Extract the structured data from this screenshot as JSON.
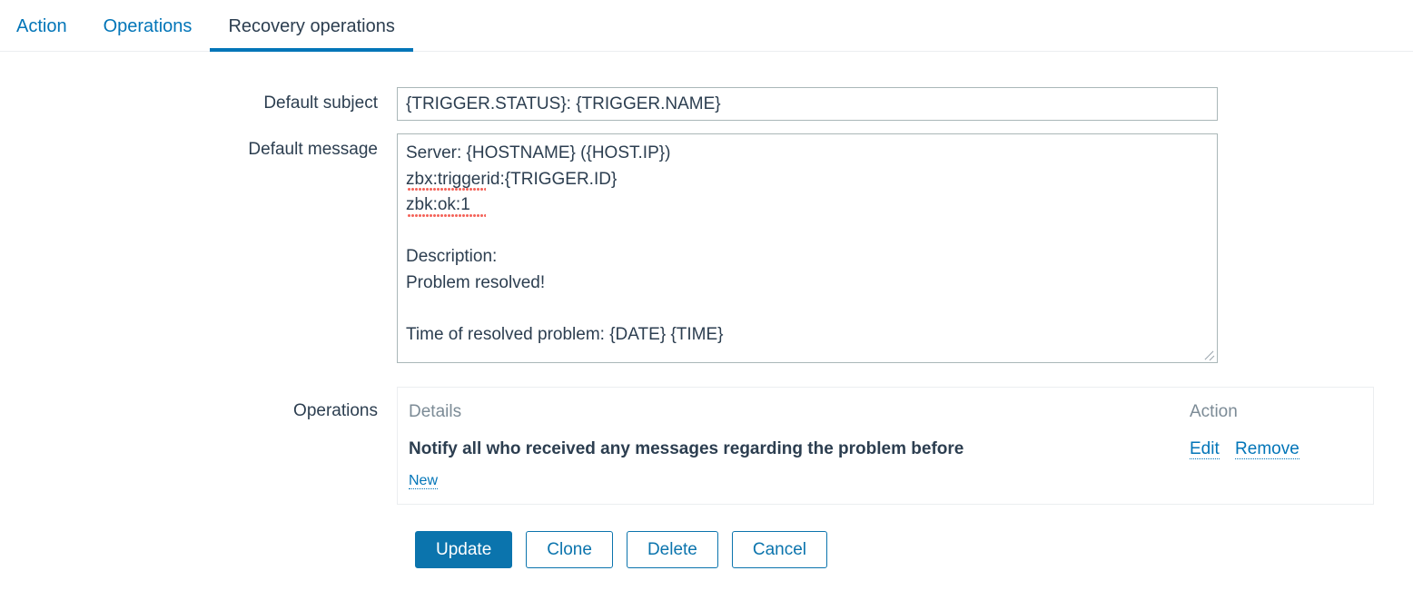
{
  "tabs": [
    {
      "label": "Action",
      "active": false
    },
    {
      "label": "Operations",
      "active": false
    },
    {
      "label": "Recovery operations",
      "active": true
    }
  ],
  "form": {
    "default_subject": {
      "label": "Default subject",
      "value": "{TRIGGER.STATUS}: {TRIGGER.NAME}",
      "placeholder": ""
    },
    "default_message": {
      "label": "Default message",
      "value": "Server: {HOSTNAME} ({HOST.IP})\nzbx:triggerid:{TRIGGER.ID}\nzbk:ok:1\n\nDescription:\nProblem resolved!\n\nTime of resolved problem: {DATE} {TIME}",
      "placeholder": ""
    },
    "operations": {
      "label": "Operations",
      "columns": {
        "details": "Details",
        "action": "Action"
      },
      "rows": [
        {
          "details": "Notify all who received any messages regarding the problem before",
          "edit_label": "Edit",
          "remove_label": "Remove"
        }
      ],
      "new_label": "New"
    }
  },
  "buttons": {
    "update": "Update",
    "clone": "Clone",
    "delete": "Delete",
    "cancel": "Cancel"
  },
  "colors": {
    "link": "#0275b8",
    "primary_button": "#0b74ad",
    "active_tab_text": "#2c3e50",
    "muted_text": "#7c8b96",
    "border": "#aab7b8",
    "panel_border": "#ebeef0",
    "spellcheck_underline": "#f4655c"
  }
}
